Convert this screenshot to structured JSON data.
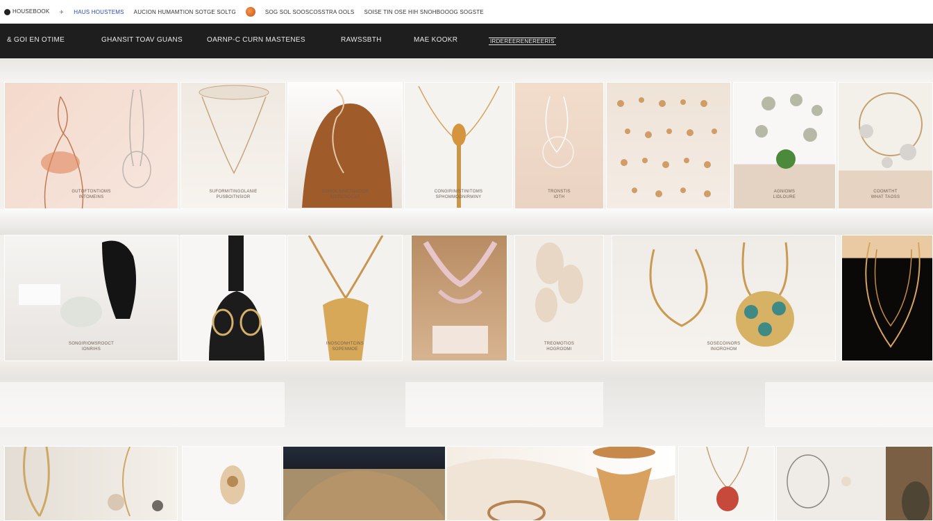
{
  "topbar": {
    "items": [
      {
        "label": "HOUSEBOOK",
        "tone": "dark"
      },
      {
        "label": "HAUS HOUSTEMS",
        "tone": "blue"
      },
      {
        "label": "AUCION HUMAMTION SOTGE SOLTG",
        "tone": "dark"
      },
      {
        "label": "SOG SOL SOOSCOSSTRA OOLS",
        "tone": "dark"
      },
      {
        "label": "SOISE TIN OSE HIH SNOHBOOOG SOGSTE",
        "tone": "dark"
      }
    ]
  },
  "nav": {
    "items": [
      {
        "label": "& GOI EN OTIME"
      },
      {
        "label": "GHANSIT TOAV GUANS"
      },
      {
        "label": "OARNP-C CURN MASTENES"
      },
      {
        "label": "RAWSSBTH"
      },
      {
        "label": "MAE KOOKR"
      },
      {
        "label": "IRDEREERENEREERIS"
      }
    ]
  },
  "products": {
    "row1": [
      {
        "caption1": "GUTOFTONTIOMS",
        "caption2": "INTOMEINS"
      },
      {
        "caption1": "SUFORMITINGOLANIE",
        "caption2": "PUSBOITNSIOR"
      },
      {
        "caption1": "SOMOCSINETONCOS",
        "caption2": "SOIRCSOCAS"
      },
      {
        "caption1": "CONGIRINISTINITOMS",
        "caption2": "SPHOMMODNIRMINY"
      },
      {
        "caption1": "TRONSTIS",
        "caption2": "IOTH"
      },
      {
        "caption1": "",
        "caption2": ""
      },
      {
        "caption1": "AGNIOMS",
        "caption2": "LIDLOURE"
      },
      {
        "caption1": "COOMITHT",
        "caption2": "WHAT TAOSS"
      }
    ],
    "row2": [
      {
        "caption1": "SONGIRIOMSROOCT",
        "caption2": "IONRIHS"
      },
      {
        "caption1": "",
        "caption2": ""
      },
      {
        "caption1": "INOSCONHTCINS",
        "caption2": "SOPENMOE"
      },
      {
        "caption1": "",
        "caption2": ""
      },
      {
        "caption1": "TREOMOTIOS",
        "caption2": "HOGROOMI"
      },
      {
        "caption1": "SOSECOINORS",
        "caption2": "INIOROHOM"
      },
      {
        "caption1": "",
        "caption2": ""
      }
    ]
  },
  "colors": {
    "nav_bg": "#1e1e1e",
    "page_bg": "#f3f1ee",
    "gold": "#c99a52"
  }
}
